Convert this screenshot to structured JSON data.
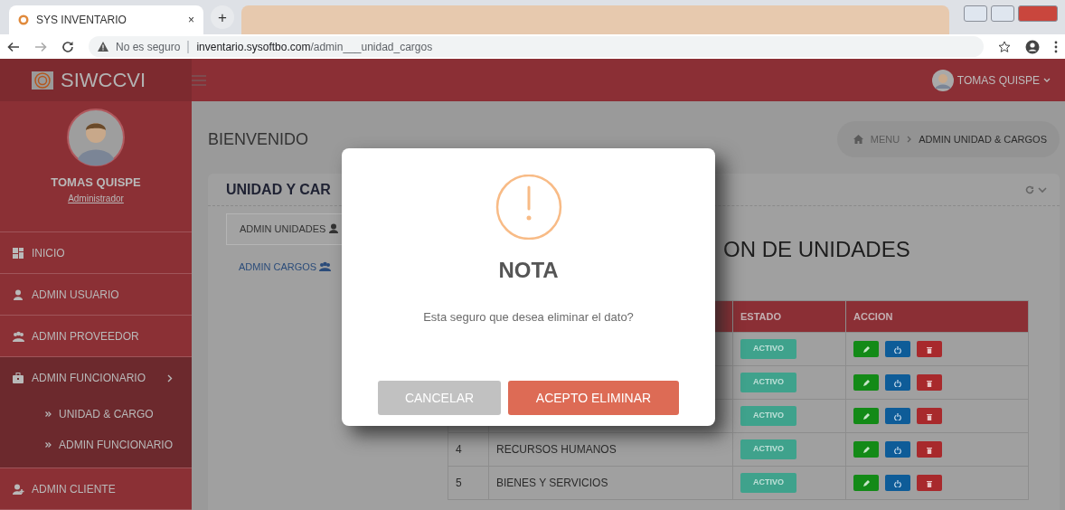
{
  "browser": {
    "tab_title": "SYS INVENTARIO",
    "tab_close": "×",
    "new_tab": "+",
    "security": "No es seguro",
    "url_host": "inventario.sysoftbo.com",
    "url_path": "/admin___unidad_cargos"
  },
  "header": {
    "brand": "SIWCCVI",
    "user": "TOMAS QUISPE"
  },
  "sidebar": {
    "profile": {
      "name": "TOMAS QUISPE",
      "role": "Administrador"
    },
    "items": [
      {
        "label": "INICIO",
        "expanded": false
      },
      {
        "label": "ADMIN USUARIO",
        "expanded": false
      },
      {
        "label": "ADMIN PROVEEDOR",
        "expanded": false
      },
      {
        "label": "ADMIN FUNCIONARIO",
        "expanded": true,
        "children": [
          {
            "label": "UNIDAD & CARGO"
          },
          {
            "label": "ADMIN FUNCIONARIO"
          }
        ]
      },
      {
        "label": "ADMIN CLIENTE",
        "expanded": false
      }
    ]
  },
  "content": {
    "greeting": "BIENVENIDO",
    "breadcrumb": [
      {
        "label": "MENU"
      },
      {
        "label": "ADMIN UNIDAD & CARGOS"
      }
    ],
    "card": {
      "title": "UNIDAD Y CAR",
      "tabs": [
        {
          "label": "ADMIN UNIDADES",
          "selected": true
        },
        {
          "label": "ADMIN CARGOS",
          "selected": false
        }
      ],
      "heading": "ON DE UNIDADES",
      "table": {
        "columns": [
          "ESTADO",
          "ACCION"
        ],
        "rows": [
          {
            "estado": "ACTIVO"
          },
          {
            "estado": "ACTIVO"
          },
          {
            "estado": "ACTIVO"
          },
          {
            "number": "4",
            "name": "RECURSOS HUMANOS",
            "estado": "ACTIVO"
          },
          {
            "number": "5",
            "name": "BIENES Y SERVICIOS",
            "estado": "ACTIVO"
          }
        ]
      }
    }
  },
  "modal": {
    "title": "NOTA",
    "message": "Esta seguro que desea eliminar el dato?",
    "buttons": [
      {
        "label": "CANCELAR",
        "kind": "cancel"
      },
      {
        "label": "ACEPTO ELIMINAR",
        "kind": "confirm"
      }
    ]
  }
}
